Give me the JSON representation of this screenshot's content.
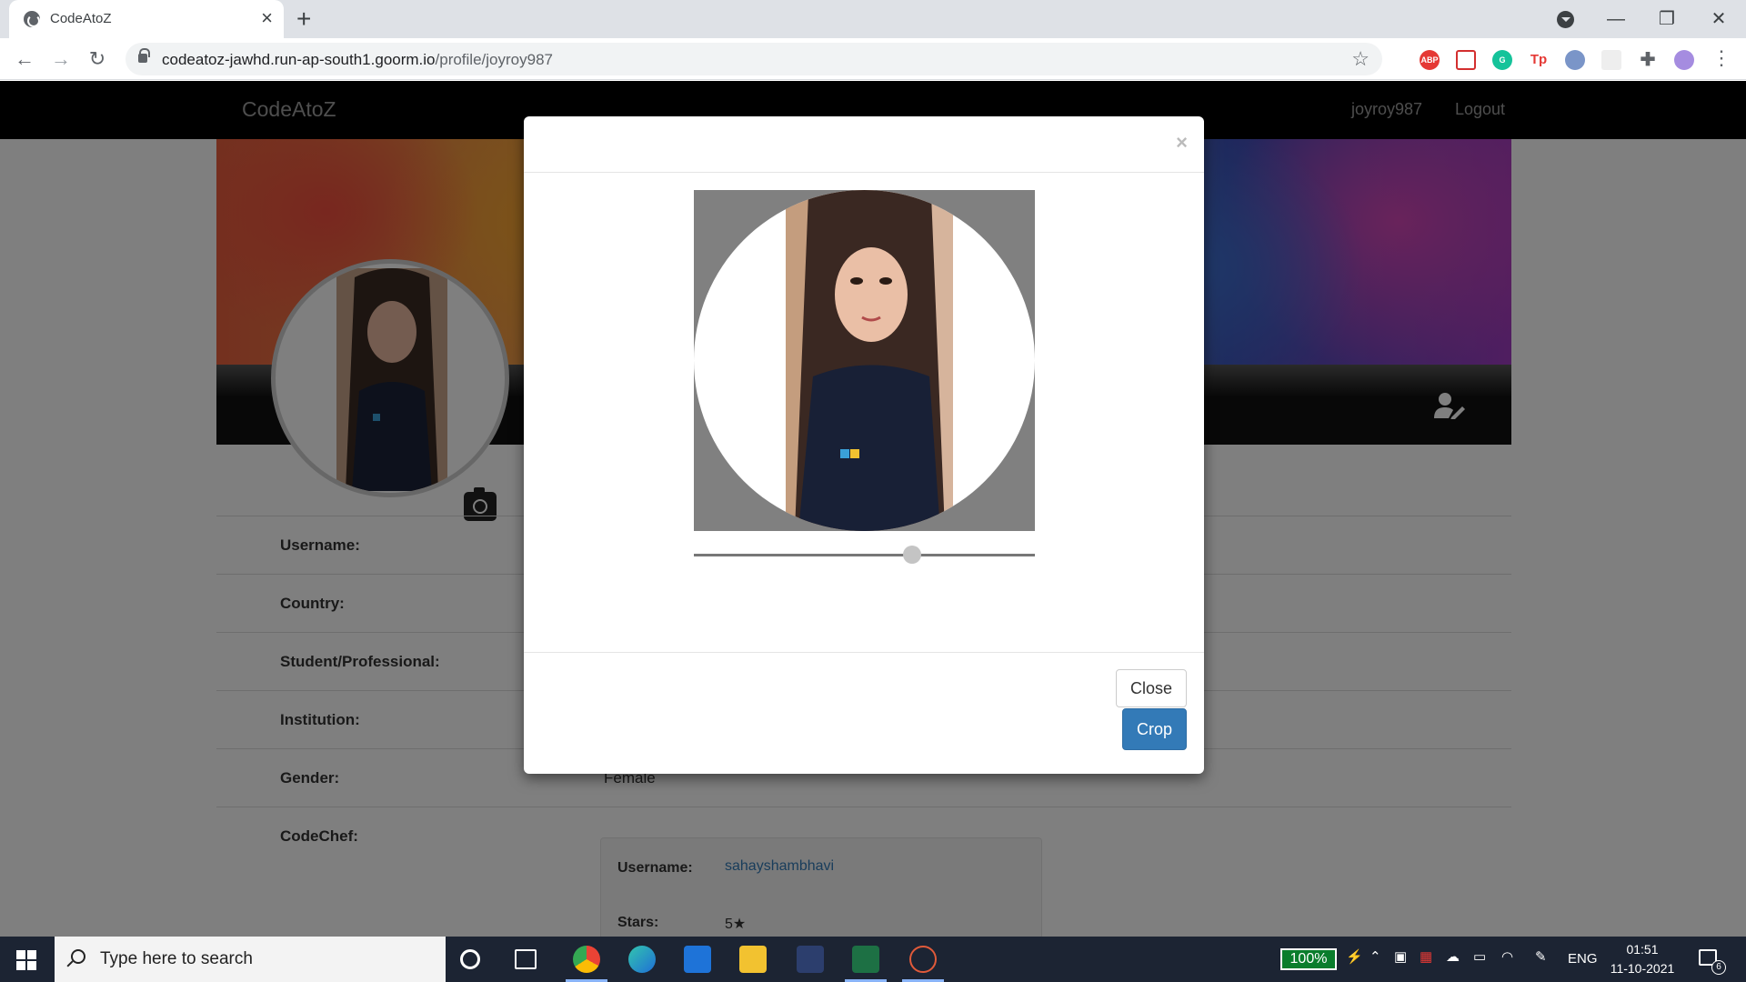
{
  "browser": {
    "tab_title": "CodeAtoZ",
    "url_host": "codeatoz-jawhd.run-ap-south1.goorm.io",
    "url_path": "/profile/joyroy987"
  },
  "navbar": {
    "brand": "CodeAtoZ",
    "username": "joyroy987",
    "logout": "Logout"
  },
  "profile": {
    "rows": [
      {
        "label": "Username:",
        "value": ""
      },
      {
        "label": "Country:",
        "value": ""
      },
      {
        "label": "Student/Professional:",
        "value": ""
      },
      {
        "label": "Institution:",
        "value": ""
      },
      {
        "label": "Gender:",
        "value": "Female"
      },
      {
        "label": "CodeChef:",
        "value": ""
      }
    ],
    "codechef": {
      "username_label": "Username:",
      "username_value": "sahayshambhavi",
      "stars_label": "Stars:",
      "stars_value": "5★"
    }
  },
  "modal": {
    "close_x": "×",
    "zoom_level": 0.64,
    "close_button": "Close",
    "crop_button": "Crop"
  },
  "taskbar": {
    "search_placeholder": "Type here to search",
    "battery": "100%",
    "language": "ENG",
    "time": "01:51",
    "date": "11-10-2021",
    "notification_count": "6"
  },
  "colors": {
    "primary_button": "#337ab7",
    "navbar_bg": "#000000",
    "battery_badge": "#0a7d2c"
  }
}
